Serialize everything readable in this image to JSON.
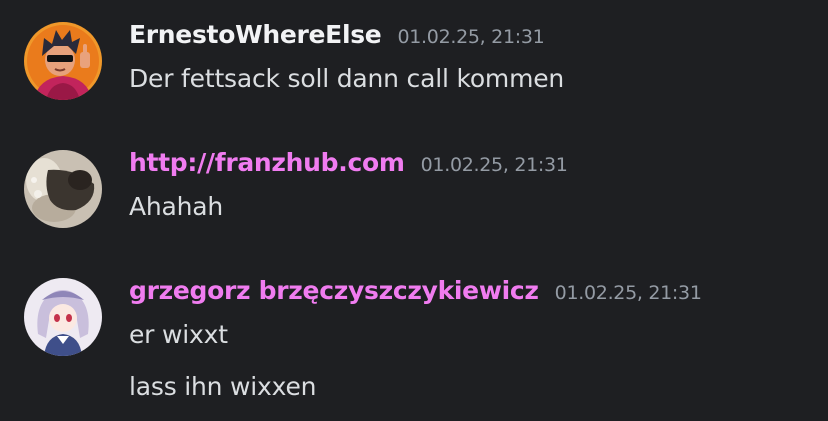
{
  "colors": {
    "background": "#1e1f22",
    "text": "#dbdee1",
    "timestamp": "#949ba4",
    "username_default": "#f2f3f5",
    "username_pink": "#f07cf0"
  },
  "messages": [
    {
      "author": "ErnestoWhereElse",
      "author_color": "#f2f3f5",
      "avatar_icon": "avatar-dark-hair-sunglasses-icon",
      "timestamp": "01.02.25, 21:31",
      "lines": [
        "Der fettsack soll dann call kommen"
      ]
    },
    {
      "author": "http://franzhub.com",
      "author_color": "#f07cf0",
      "avatar_icon": "avatar-blurry-photo-icon",
      "timestamp": "01.02.25, 21:31",
      "lines": [
        "Ahahah"
      ]
    },
    {
      "author": "grzegorz brzęczyszczykiewicz",
      "author_color": "#f07cf0",
      "avatar_icon": "avatar-anime-character-icon",
      "timestamp": "01.02.25, 21:31",
      "lines": [
        "er wixxt",
        "lass ihn wixxen"
      ]
    }
  ]
}
